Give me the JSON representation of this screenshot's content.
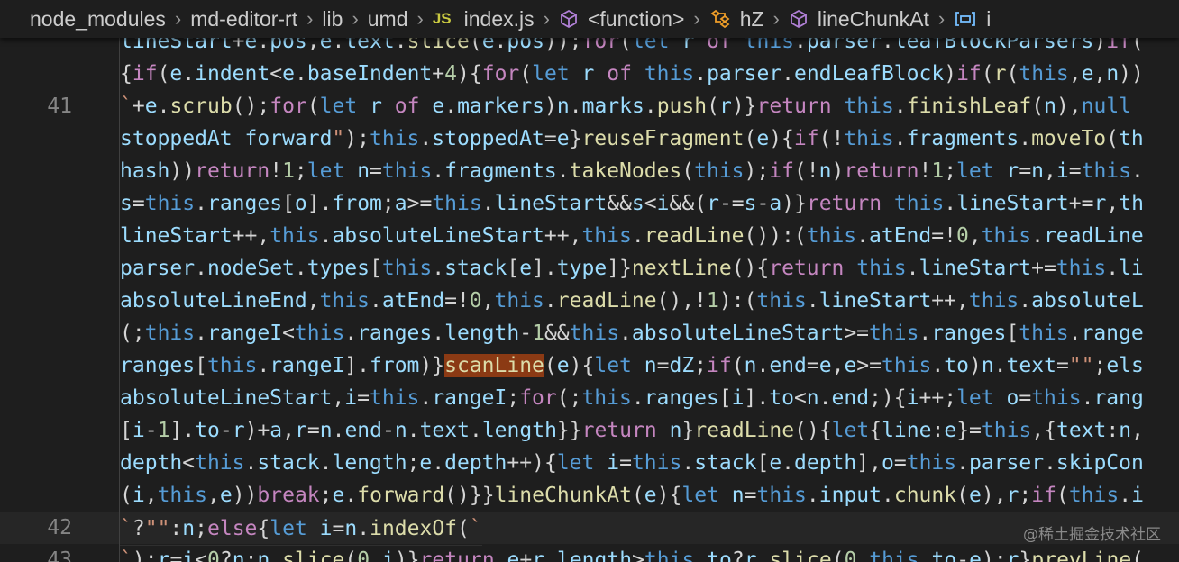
{
  "breadcrumb": {
    "items": [
      "node_modules",
      "md-editor-rt",
      "lib",
      "umd",
      "index.js",
      "<function>",
      "hZ",
      "lineChunkAt",
      "i"
    ],
    "file_badge": "JS"
  },
  "lines": [
    {
      "num": "",
      "code": "lineStart+e.pos,e.text.slice(e.pos));for(let r of this.parser.leafBlockParsers)if("
    },
    {
      "num": "",
      "code": "{if(e.indent<e.baseIndent+4){for(let r of this.parser.endLeafBlock)if(r(this,e,n))"
    },
    {
      "num": "41",
      "code": "`+e.scrub();for(let r of e.markers)n.marks.push(r)}return this.finishLeaf(n),null"
    },
    {
      "num": "",
      "code": "stoppedAt forward\");this.stoppedAt=e}reuseFragment(e){if(!this.fragments.moveTo(th"
    },
    {
      "num": "",
      "code": "hash))return!1;let n=this.fragments.takeNodes(this);if(!n)return!1;let r=n,i=this."
    },
    {
      "num": "",
      "code": "s=this.ranges[o].from;a>=this.lineStart&&s<i&&(r-=s-a)}return this.lineStart+=r,th"
    },
    {
      "num": "",
      "code": "lineStart++,this.absoluteLineStart++,this.readLine()):(this.atEnd=!0,this.readLine"
    },
    {
      "num": "",
      "code": "parser.nodeSet.types[this.stack[e].type]}nextLine(){return this.lineStart+=this.li"
    },
    {
      "num": "",
      "code": "absoluteLineEnd,this.atEnd=!0,this.readLine(),!1):(this.lineStart++,this.absoluteL"
    },
    {
      "num": "",
      "code": "(;this.rangeI<this.ranges.length-1&&this.absoluteLineStart>=this.ranges[this.range"
    },
    {
      "num": "",
      "code": "ranges[this.rangeI].from)}scanLine(e){let n=dZ;if(n.end=e,e>=this.to)n.text=\"\";els"
    },
    {
      "num": "",
      "code": "absoluteLineStart,i=this.rangeI;for(;this.ranges[i].to<n.end;){i++;let o=this.rang"
    },
    {
      "num": "",
      "code": "[i-1].to-r)+a,r=n.end-n.text.length}}return n}readLine(){let{line:e}=this,{text:n,"
    },
    {
      "num": "",
      "code": "depth<this.stack.length;e.depth++){let i=this.stack[e.depth],o=this.parser.skipCon"
    },
    {
      "num": "",
      "code": "(i,this,e))break;e.forward()}}lineChunkAt(e){let n=this.input.chunk(e),r;if(this.i"
    },
    {
      "num": "42",
      "code": "`?\"\":n;else{let i=n.indexOf(`"
    },
    {
      "num": "43",
      "code": "`);r=i<0?n:n.slice(0,i)}return e+r.length>this.to?r.slice(0,this.to-e):r}prevLine("
    }
  ],
  "highlight_word": "scanLine",
  "current_line_index": 15,
  "watermark": "@稀土掘金技术社区"
}
